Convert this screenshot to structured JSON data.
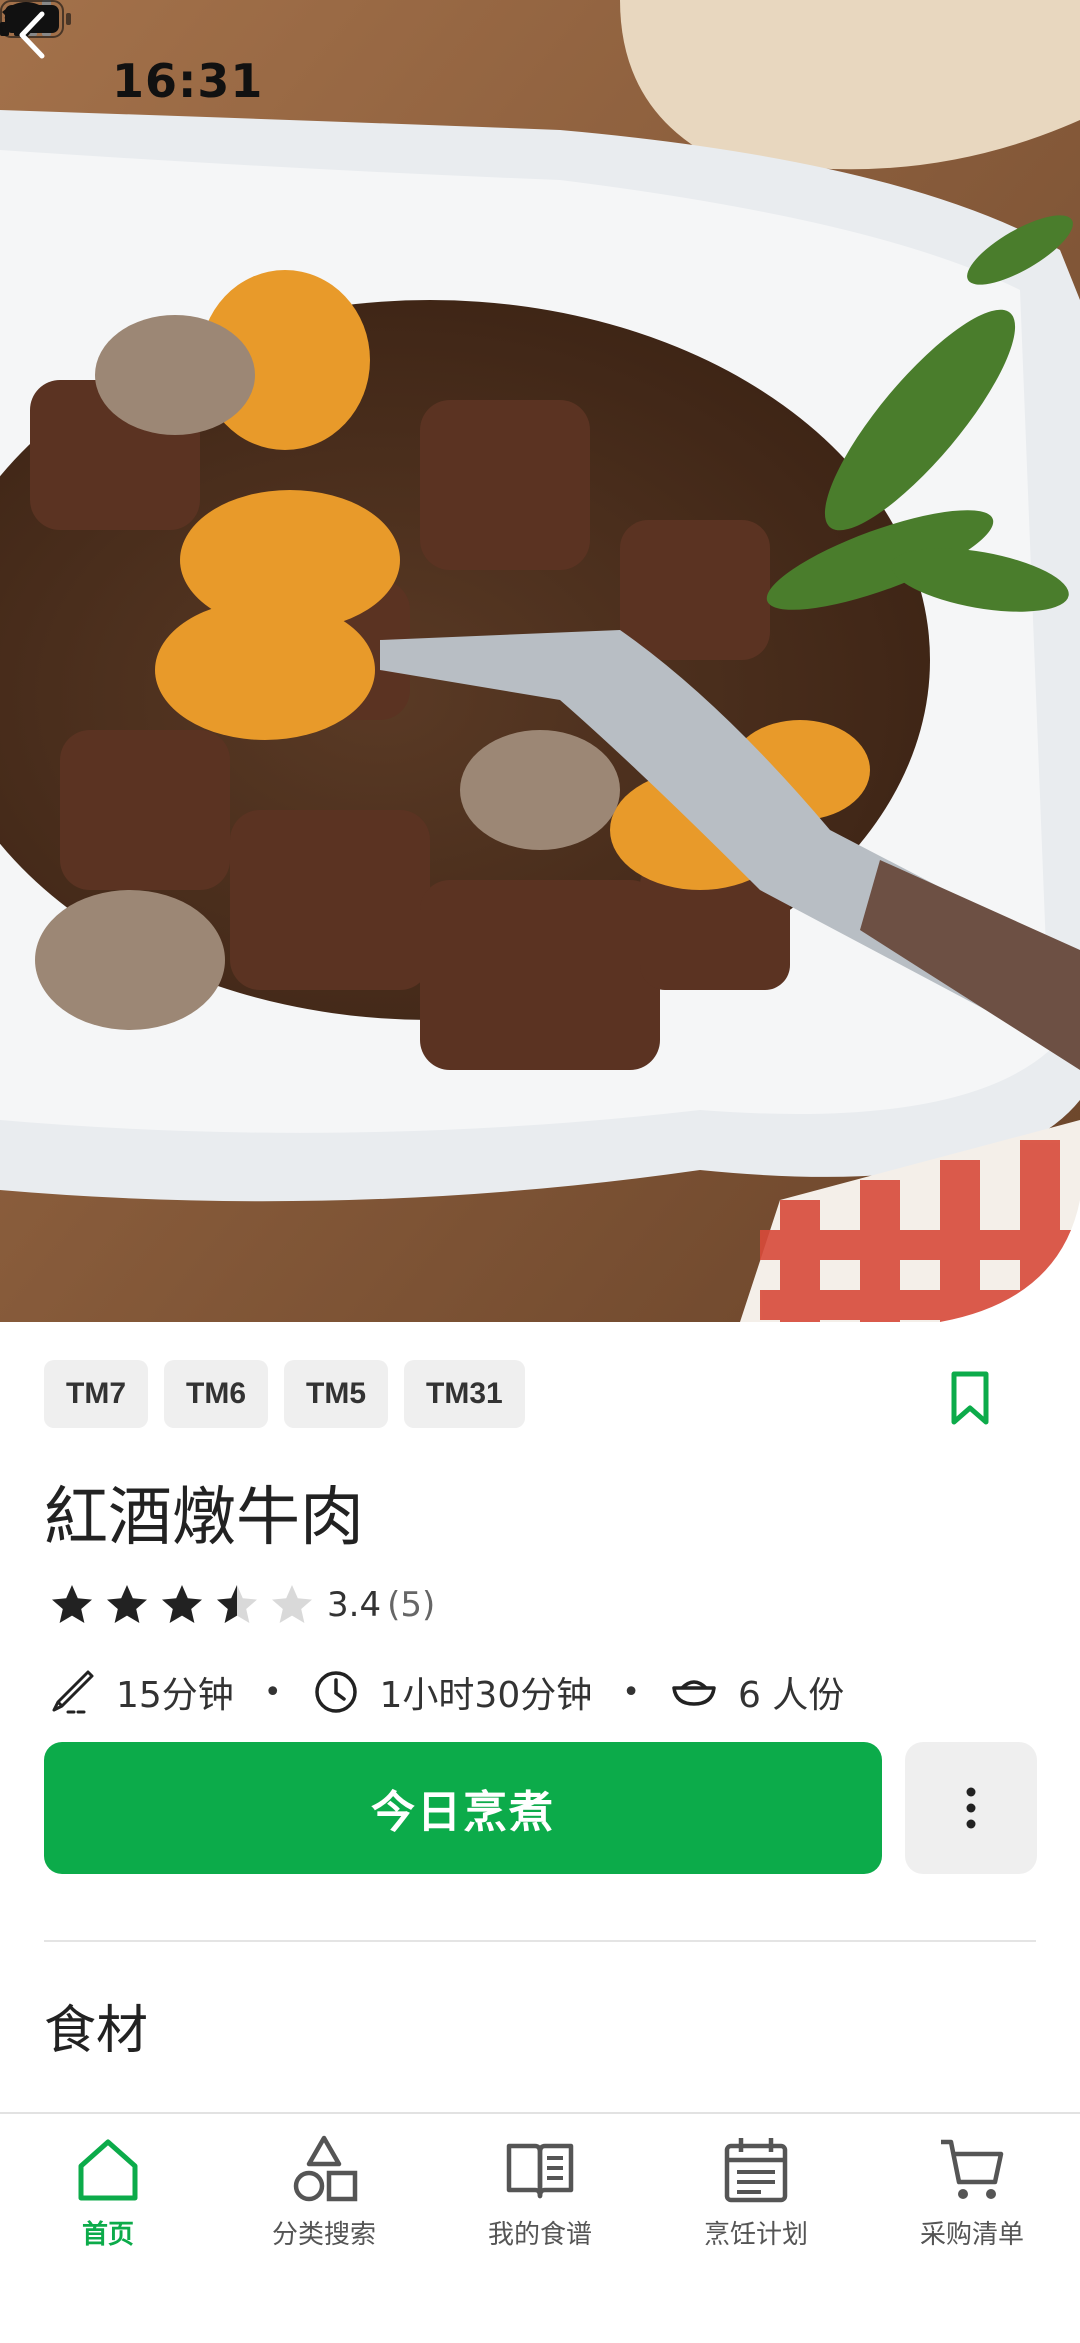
{
  "status_bar": {
    "time": "16:31"
  },
  "recipe": {
    "tags": [
      "TM7",
      "TM6",
      "TM5",
      "TM31"
    ],
    "title": "紅酒燉牛肉",
    "rating": {
      "value": "3.4",
      "count": "(5)",
      "stars_filled": 3.4
    },
    "prep_time": "15分钟",
    "total_time": "1小时30分钟",
    "servings": "6 人份",
    "cook_button": "今日烹煮",
    "section_ingredients": "食材"
  },
  "colors": {
    "accent": "#0cab4a"
  },
  "tabbar": {
    "items": [
      {
        "label": "首页",
        "icon": "home-icon",
        "active": true
      },
      {
        "label": "分类搜索",
        "icon": "shapes-icon",
        "active": false
      },
      {
        "label": "我的食谱",
        "icon": "book-icon",
        "active": false
      },
      {
        "label": "烹饪计划",
        "icon": "calendar-icon",
        "active": false
      },
      {
        "label": "采购清单",
        "icon": "cart-icon",
        "active": false
      }
    ]
  }
}
